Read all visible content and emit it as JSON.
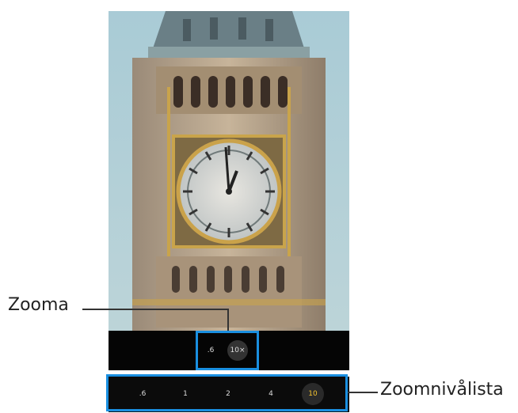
{
  "callouts": {
    "zoom_label": "Zooma",
    "zoom_list_label": "Zoomnivålista"
  },
  "zoom_toggle": {
    "options": [
      ".6",
      "10×"
    ],
    "selected": "10×"
  },
  "zoom_levels": {
    "items": [
      ".6",
      "1",
      "2",
      "4",
      "10"
    ],
    "selected": "10",
    "selected_color": "#f4c430"
  },
  "scene": {
    "subject": "clock-tower-photo"
  }
}
